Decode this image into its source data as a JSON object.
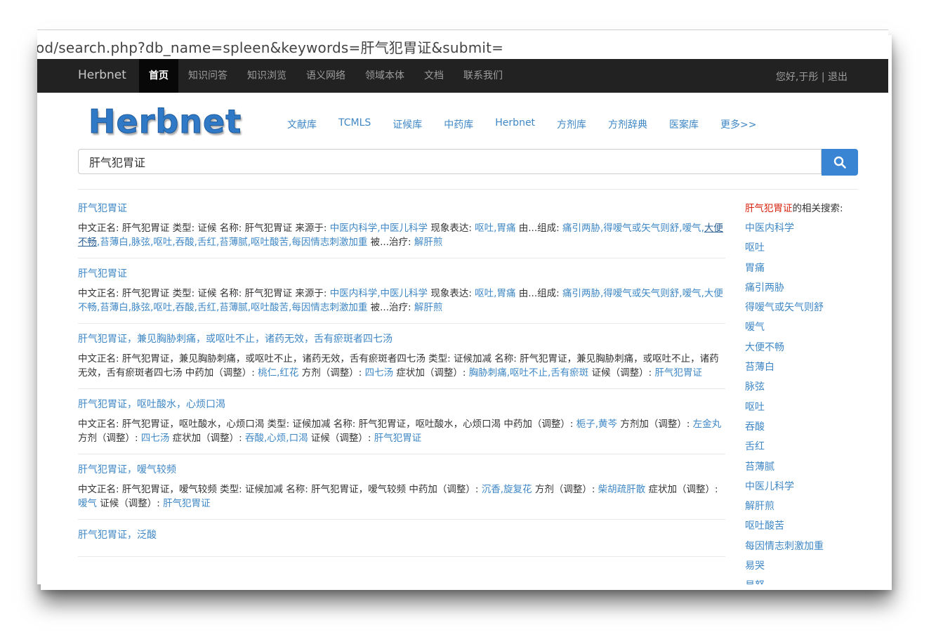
{
  "url": "od/search.php?db_name=spleen&keywords=肝气犯胃证&submit=",
  "navbar": {
    "brand": "Herbnet",
    "items": [
      {
        "label": "首页",
        "active": true
      },
      {
        "label": "知识问答"
      },
      {
        "label": "知识浏览"
      },
      {
        "label": "语义网络"
      },
      {
        "label": "领域本体"
      },
      {
        "label": "文档"
      },
      {
        "label": "联系我们"
      }
    ],
    "user": "您好,于彤 | 退出"
  },
  "logo": "Herbnet",
  "site_links": [
    "文献库",
    "TCMLS",
    "证候库",
    "中药库",
    "Herbnet",
    "方剂库",
    "方剂辞典",
    "医案库",
    "更多>>"
  ],
  "search": {
    "value": "肝气犯胃证"
  },
  "results": [
    {
      "title": "肝气犯胃证",
      "segments": [
        {
          "t": "中文正名: 肝气犯胃证 类型: 证候 名称: 肝气犯胃证 来源于: "
        },
        {
          "t": "中医内科学,中医儿科学",
          "link": true
        },
        {
          "t": " 现象表达: "
        },
        {
          "t": "呕吐,胃痛",
          "link": true
        },
        {
          "t": " 由...组成: "
        },
        {
          "t": "痛引两胁,得嗳气或矢气则舒,嗳气,",
          "link": true
        },
        {
          "t": "大便不畅",
          "link": true,
          "underline": true
        },
        {
          "t": ",苔薄白,脉弦,呕吐,吞酸,舌红,苔薄腻,呕吐酸苦,每因情志刺激加重",
          "link": true
        },
        {
          "t": " 被...治疗: "
        },
        {
          "t": "解肝煎",
          "link": true
        }
      ]
    },
    {
      "title": "肝气犯胃证",
      "segments": [
        {
          "t": "中文正名: 肝气犯胃证 类型: 证候 名称: 肝气犯胃证 来源于: "
        },
        {
          "t": "中医内科学,中医儿科学",
          "link": true
        },
        {
          "t": " 现象表达: "
        },
        {
          "t": "呕吐,胃痛",
          "link": true
        },
        {
          "t": " 由...组成: "
        },
        {
          "t": "痛引两胁,得嗳气或矢气则舒,嗳气,大便不畅,苔薄白,脉弦,呕吐,吞酸,舌红,苔薄腻,呕吐酸苦,每因情志刺激加重",
          "link": true
        },
        {
          "t": " 被...治疗: "
        },
        {
          "t": "解肝煎",
          "link": true
        }
      ]
    },
    {
      "title": "肝气犯胃证，兼见胸胁刺痛，或呕吐不止，诸药无效，舌有瘀斑者四七汤",
      "segments": [
        {
          "t": "中文正名: 肝气犯胃证，兼见胸胁刺痛，或呕吐不止，诸药无效，舌有瘀斑者四七汤 类型: 证候加减 名称: 肝气犯胃证，兼见胸胁刺痛，或呕吐不止，诸药无效，舌有瘀斑者四七汤 中药加（调整）: "
        },
        {
          "t": "桃仁,红花",
          "link": true
        },
        {
          "t": " 方剂（调整）: "
        },
        {
          "t": "四七汤",
          "link": true
        },
        {
          "t": " 症状加（调整）: "
        },
        {
          "t": "胸胁刺痛,呕吐不止,舌有瘀斑",
          "link": true
        },
        {
          "t": " 证候（调整）: "
        },
        {
          "t": "肝气犯胃证",
          "link": true
        }
      ]
    },
    {
      "title": "肝气犯胃证，呕吐酸水，心烦口渴",
      "segments": [
        {
          "t": "中文正名: 肝气犯胃证，呕吐酸水，心烦口渴 类型: 证候加减 名称: 肝气犯胃证，呕吐酸水，心烦口渴 中药加（调整）: "
        },
        {
          "t": "栀子,黄芩",
          "link": true
        },
        {
          "t": " 方剂加（调整）: "
        },
        {
          "t": "左金丸",
          "link": true
        },
        {
          "t": " 方剂（调整）: "
        },
        {
          "t": "四七汤",
          "link": true
        },
        {
          "t": " 症状加（调整）: "
        },
        {
          "t": "吞酸,心烦,口渴",
          "link": true
        },
        {
          "t": " 证候（调整）: "
        },
        {
          "t": "肝气犯胃证",
          "link": true
        }
      ]
    },
    {
      "title": "肝气犯胃证，嗳气较频",
      "segments": [
        {
          "t": "中文正名: 肝气犯胃证，嗳气较频 类型: 证候加减 名称: 肝气犯胃证，嗳气较频 中药加（调整）: "
        },
        {
          "t": "沉香,旋复花",
          "link": true
        },
        {
          "t": " 方剂（调整）: "
        },
        {
          "t": "柴胡疏肝散",
          "link": true
        },
        {
          "t": " 症状加（调整）: "
        },
        {
          "t": "嗳气",
          "link": true
        },
        {
          "t": " 证候（调整）: "
        },
        {
          "t": "肝气犯胃证",
          "link": true
        }
      ]
    },
    {
      "title": "肝气犯胃证，泛酸",
      "segments": []
    }
  ],
  "sidebar": {
    "keyword": "肝气犯胃证",
    "suffix": "的相关搜索:",
    "items": [
      "中医内科学",
      "呕吐",
      "胃痛",
      "痛引两胁",
      "得嗳气或矢气则舒",
      "嗳气",
      "大便不畅",
      "苔薄白",
      "脉弦",
      "呕吐",
      "吞酸",
      "舌红",
      "苔薄腻",
      "中医儿科学",
      "解肝煎",
      "呕吐酸苦",
      "每因情志刺激加重",
      "易哭",
      "易怒"
    ]
  }
}
